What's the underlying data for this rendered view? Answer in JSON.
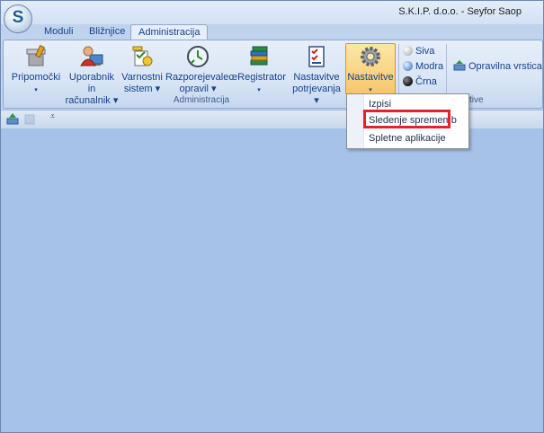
{
  "window": {
    "title": "S.K.I.P.  d.o.o. - Seyfor Saop"
  },
  "tabs": [
    {
      "label": "Moduli"
    },
    {
      "label": "Bližnjice"
    },
    {
      "label": "Administracija"
    }
  ],
  "ribbon": {
    "group_label": "Administracija",
    "partial_group_label": "tive",
    "buttons": [
      {
        "line1": "Pripomočki",
        "line2": "▾"
      },
      {
        "line1": "Uporabnik in",
        "line2": "računalnik ▾"
      },
      {
        "line1": "Varnostni",
        "line2": "sistem ▾"
      },
      {
        "line1": "Razporejevalec",
        "line2": "opravil ▾"
      },
      {
        "line1": "eRegistrator",
        "line2": "▾"
      },
      {
        "line1": "Nastavitve",
        "line2": "potrjevanja ▾"
      },
      {
        "line1": "Nastavitve",
        "line2": "▾"
      }
    ],
    "themes": [
      {
        "label": "Siva",
        "color": "#c8c8c8"
      },
      {
        "label": "Modra",
        "color": "#6fa1dc"
      },
      {
        "label": "Črna",
        "color": "#202020"
      }
    ],
    "task_bar": "Opravilna vrstica"
  },
  "menu": {
    "items": [
      {
        "label": "Izpisi"
      },
      {
        "label": "Sledenje sprememb"
      },
      {
        "label": "Spletne aplikacije"
      }
    ]
  },
  "colors": {
    "workspace": "#a7c2e8",
    "highlight": "#e32229",
    "ribbon_text": "#15428b"
  }
}
